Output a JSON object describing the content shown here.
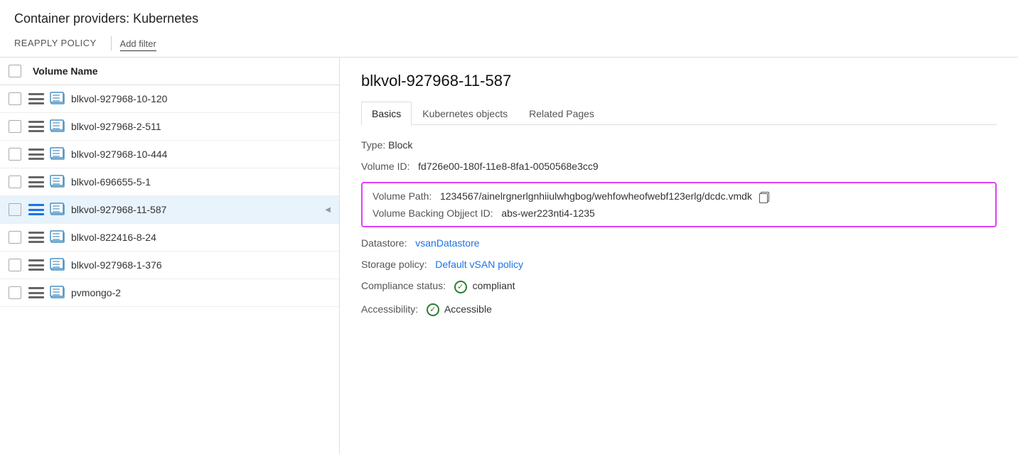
{
  "header": {
    "title": "Container providers:  Kubernetes"
  },
  "toolbar": {
    "reapply_label": "REAPPLY POLICY",
    "filter_label": "Add filter"
  },
  "list": {
    "header_label": "Volume Name",
    "items": [
      {
        "id": 1,
        "name": "blkvol-927968-10-120",
        "selected": false
      },
      {
        "id": 2,
        "name": "blkvol-927968-2-511",
        "selected": false
      },
      {
        "id": 3,
        "name": "blkvol-927968-10-444",
        "selected": false
      },
      {
        "id": 4,
        "name": "blkvol-696655-5-1",
        "selected": false
      },
      {
        "id": 5,
        "name": "blkvol-927968-11-587",
        "selected": true
      },
      {
        "id": 6,
        "name": "blkvol-822416-8-24",
        "selected": false
      },
      {
        "id": 7,
        "name": "blkvol-927968-1-376",
        "selected": false
      },
      {
        "id": 8,
        "name": "pvmongo-2",
        "selected": false
      }
    ]
  },
  "detail": {
    "title": "blkvol-927968-11-587",
    "tabs": [
      {
        "label": "Basics",
        "active": true
      },
      {
        "label": "Kubernetes objects",
        "active": false
      },
      {
        "label": "Related Pages",
        "active": false
      }
    ],
    "type_label": "Type:",
    "type_value": "Block",
    "volume_id_label": "Volume ID:",
    "volume_id_value": "fd726e00-180f-11e8-8fa1-0050568e3cc9",
    "volume_path_label": "Volume Path:",
    "volume_path_value": "1234567/ainelrgnerlgnhiiulwhgbog/wehfowheofwebf123erlg/dcdc.vmdk",
    "volume_backing_label": "Volume Backing Objject ID:",
    "volume_backing_value": "abs-wer223nti4-1235",
    "datastore_label": "Datastore:",
    "datastore_value": "vsanDatastore",
    "storage_policy_label": "Storage policy:",
    "storage_policy_value": "Default vSAN policy",
    "compliance_label": "Compliance status:",
    "compliance_value": "compliant",
    "accessibility_label": "Accessibility:",
    "accessibility_value": "Accessible"
  }
}
